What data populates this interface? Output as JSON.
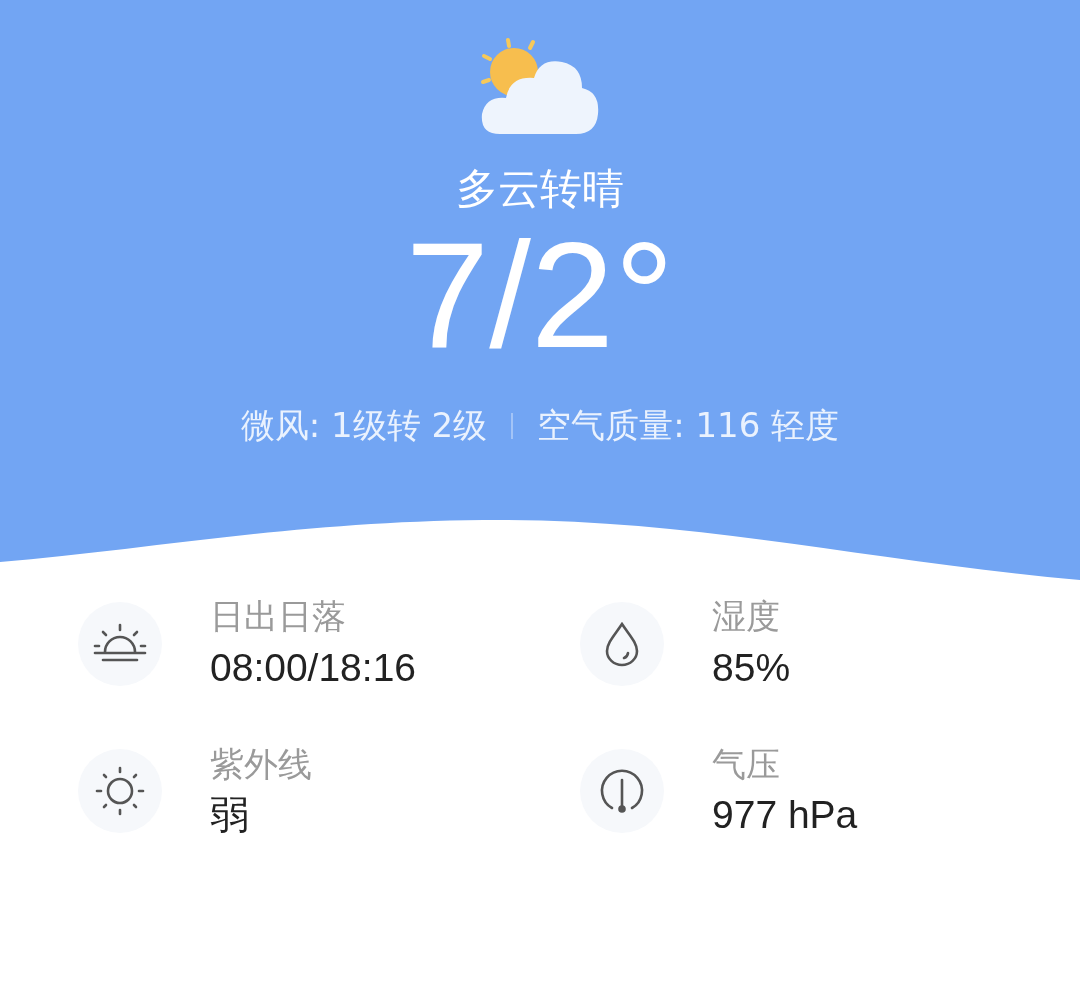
{
  "weather": {
    "condition": "多云转晴",
    "temperature": "7/2°",
    "wind": "微风: 1级转 2级",
    "air_quality": "空气质量: 116 轻度"
  },
  "details": [
    {
      "kind": "sunrise",
      "label": "日出日落",
      "value": "08:00/18:16"
    },
    {
      "kind": "humidity",
      "label": "湿度",
      "value": "85%"
    },
    {
      "kind": "uv",
      "label": "紫外线",
      "value": "弱"
    },
    {
      "kind": "pressure",
      "label": "气压",
      "value": "977 hPa"
    }
  ]
}
